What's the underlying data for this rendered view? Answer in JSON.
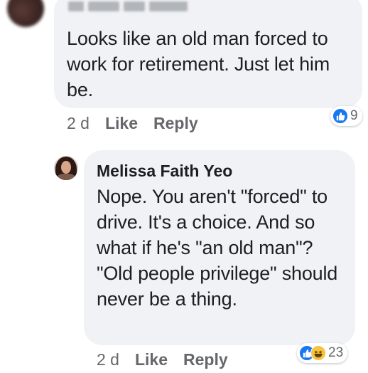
{
  "first_comment": {
    "author": "",
    "text": "Looks like an old man forced to work for retirement. Just let him be.",
    "time": "2 d",
    "like_label": "Like",
    "reply_label": "Reply",
    "reaction_icons": [
      "like-icon"
    ],
    "reaction_count": "9"
  },
  "reply": {
    "author": "Melissa Faith Yeo",
    "text": "Nope. You aren't \"forced\" to drive. It's a choice. And so what if he's \"an old man\"? \"Old people privilege\" should never be a thing.",
    "time": "2 d",
    "like_label": "Like",
    "reply_label": "Reply",
    "reaction_icons": [
      "like-icon",
      "haha-icon"
    ],
    "reaction_count": "23"
  },
  "colors": {
    "bubble_bg": "#f0f2f5",
    "secondary_text": "#65676b",
    "like_blue": "#1877f2",
    "haha_yellow": "#f7c33e"
  }
}
